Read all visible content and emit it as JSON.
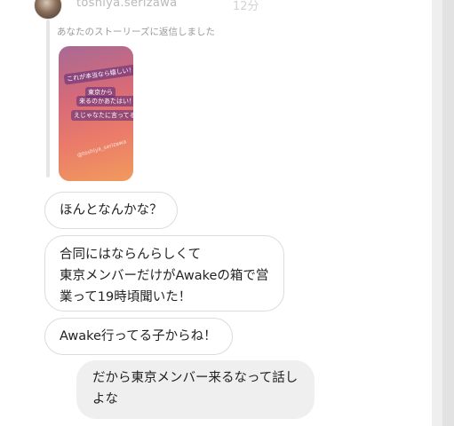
{
  "header": {
    "username": "toshiya.serizawa",
    "timestamp": "12分"
  },
  "reply": {
    "label": "あなたのストーリーズに返信しました",
    "story_text": {
      "line1": "これが本当なら嬉しい！",
      "line2": "東京から",
      "line3": "来るのかあたはい！",
      "line4": "えじゃなたに言ってる",
      "handle": "@toshiya_serizawa"
    }
  },
  "messages": [
    {
      "sender": "them",
      "text": "ほんとなんかな？"
    },
    {
      "sender": "them",
      "text": "合同にはならんらしくて\n東京メンバーだけがAwakeの箱で営\n業って19時頃聞いた！"
    },
    {
      "sender": "them",
      "text": "Awake行ってる子からね！"
    },
    {
      "sender": "me",
      "text": "だから東京メンバー来るなって話し\nよな"
    }
  ],
  "colors": {
    "bubble_border": "#dcdcdc",
    "my_bubble_bg": "#efefef",
    "story_gradient_start": "#a86a94",
    "story_gradient_end": "#f19a5d"
  }
}
